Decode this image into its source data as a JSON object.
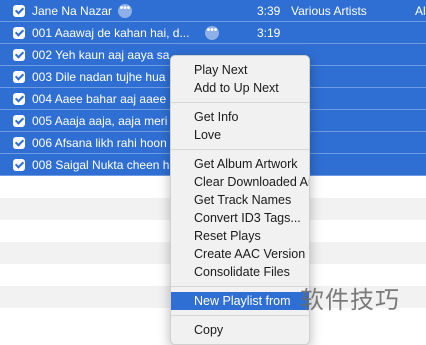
{
  "tracks": [
    {
      "name": "Jane Na Nazar",
      "time": "3:39",
      "artist": "Various Artists",
      "album": "Al"
    },
    {
      "name": "001 Aaawaj de kahan hai, d...",
      "time": "3:19",
      "artist": "",
      "album": ""
    },
    {
      "name": "002 Yeh kaun aaj aaya sa",
      "time": "",
      "artist": "",
      "album": ""
    },
    {
      "name": "003 Dile nadan tujhe hua",
      "time": "",
      "artist": "",
      "album": ""
    },
    {
      "name": "004 Aaee bahar aaj aaee",
      "time": "",
      "artist": "",
      "album": ""
    },
    {
      "name": "005 Aaaja aaja, aaja meri",
      "time": "",
      "artist": "",
      "album": ""
    },
    {
      "name": "006 Afsana likh rahi hoon",
      "time": "",
      "artist": "",
      "album": ""
    },
    {
      "name": "008 Saigal Nukta cheen h",
      "time": "",
      "artist": "",
      "album": ""
    }
  ],
  "more_glyph": "•••",
  "menu": {
    "group1": [
      "Play Next",
      "Add to Up Next"
    ],
    "group2": [
      "Get Info",
      "Love"
    ],
    "group3": [
      "Get Album Artwork",
      "Clear Downloaded Artwork",
      "Get Track Names",
      "Convert ID3 Tags...",
      "Reset Plays",
      "Create AAC Version",
      "Consolidate Files"
    ],
    "highlighted": "New Playlist from",
    "last": "Copy"
  },
  "watermark": "软件技巧",
  "colors": {
    "selection": "#2f6fd3",
    "menu_bg": "#f1f1f1"
  }
}
